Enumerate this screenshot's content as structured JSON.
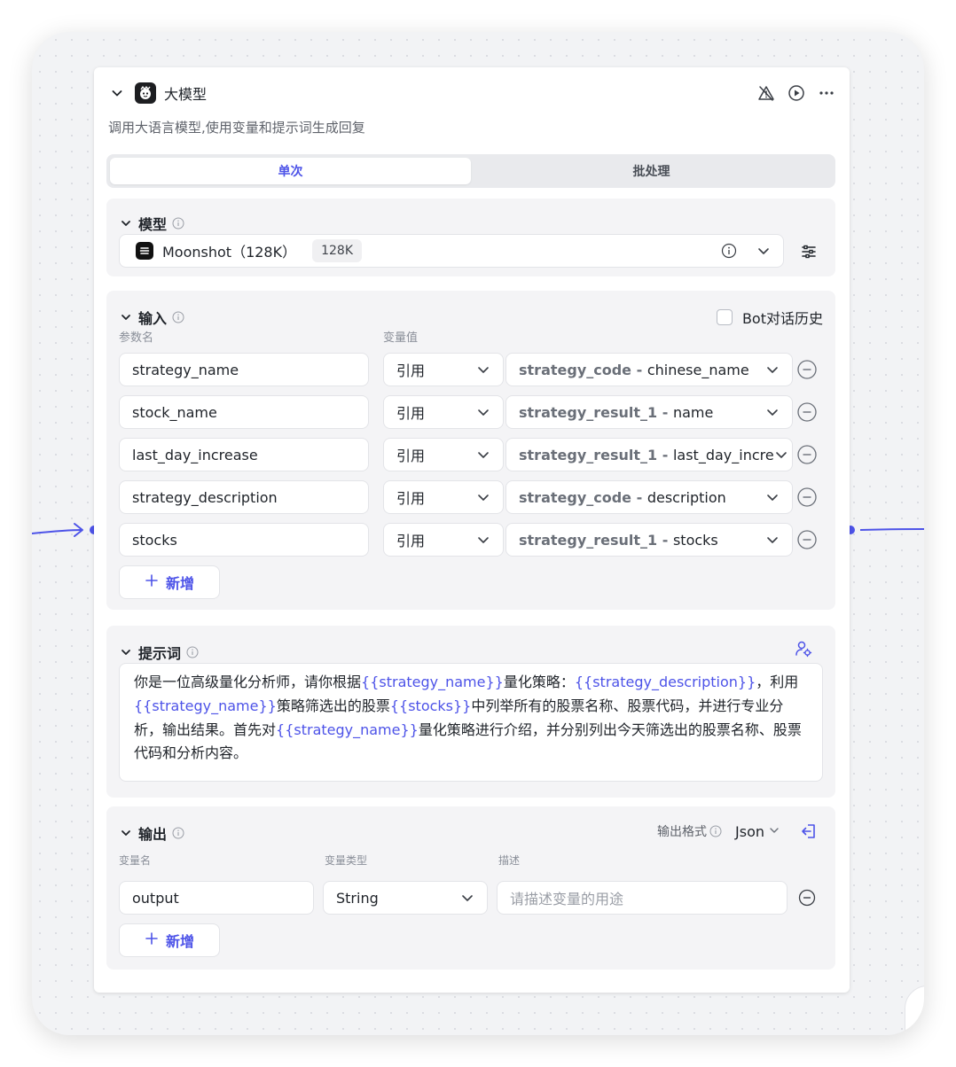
{
  "node": {
    "title": "大模型",
    "description": "调用大语言模型,使用变量和提示词生成回复"
  },
  "mode_tabs": [
    {
      "label": "单次",
      "active": true
    },
    {
      "label": "批处理",
      "active": false
    }
  ],
  "model_section": {
    "title": "模型",
    "model_name": "Moonshot（128K）",
    "context_badge": "128K"
  },
  "input_section": {
    "title": "输入",
    "bot_history_label": "Bot对话历史",
    "bot_history_checked": false,
    "param_name_header": "参数名",
    "value_header": "变量值",
    "rows": [
      {
        "name": "strategy_name",
        "ref_type": "引用",
        "ref_node": "strategy_code - ",
        "ref_var": "chinese_name"
      },
      {
        "name": "stock_name",
        "ref_type": "引用",
        "ref_node": "strategy_result_1 - ",
        "ref_var": "name"
      },
      {
        "name": "last_day_increase",
        "ref_type": "引用",
        "ref_node": "strategy_result_1 - ",
        "ref_var": "last_day_incre"
      },
      {
        "name": "strategy_description",
        "ref_type": "引用",
        "ref_node": "strategy_code - ",
        "ref_var": "description"
      },
      {
        "name": "stocks",
        "ref_type": "引用",
        "ref_node": "strategy_result_1 - ",
        "ref_var": "stocks"
      }
    ],
    "add_label": "新增"
  },
  "prompt_section": {
    "title": "提示词",
    "segments": [
      {
        "text": "你是一位高级量化分析师，请你根据",
        "var": false
      },
      {
        "text": "{{strategy_name}}",
        "var": true
      },
      {
        "text": "量化策略：",
        "var": false
      },
      {
        "text": "{{strategy_description}}",
        "var": true
      },
      {
        "text": "，利用",
        "var": false
      },
      {
        "text": "{{strategy_name}}",
        "var": true
      },
      {
        "text": "策略筛选出的股票",
        "var": false
      },
      {
        "text": "{{stocks}}",
        "var": true
      },
      {
        "text": "中列举所有的股票名称、股票代码，并进行专业分析，输出结果。首先对",
        "var": false
      },
      {
        "text": "{{strategy_name}}",
        "var": true
      },
      {
        "text": "量化策略进行介绍，并分别列出今天筛选出的股票名称、股票代码和分析内容。",
        "var": false
      }
    ]
  },
  "output_section": {
    "title": "输出",
    "format_label": "输出格式",
    "format_value": "Json",
    "var_name_header": "变量名",
    "var_type_header": "变量类型",
    "desc_header": "描述",
    "rows": [
      {
        "name": "output",
        "type": "String",
        "desc_placeholder": "请描述变量的用途"
      }
    ],
    "add_label": "新增"
  },
  "colors": {
    "accent": "#4d53e8",
    "canvas_bg": "#f2f3f5",
    "section_bg": "#f4f4f6"
  }
}
